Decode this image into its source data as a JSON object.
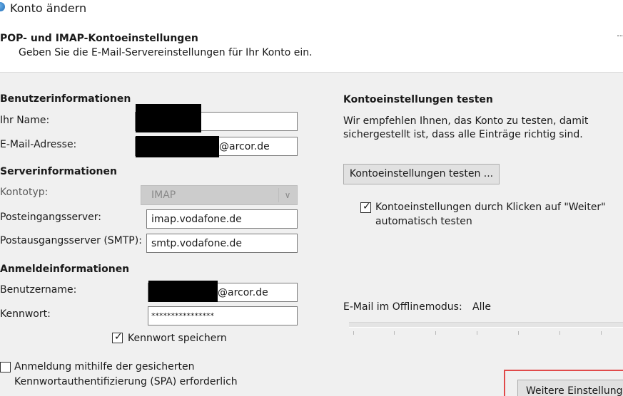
{
  "window": {
    "title": "Konto ändern"
  },
  "header": {
    "title": "POP- und IMAP-Kontoeinstellungen",
    "subtitle": "Geben Sie die E-Mail-Servereinstellungen für Ihr Konto ein."
  },
  "user_info": {
    "section": "Benutzerinformationen",
    "name_label": "Ihr Name:",
    "email_label": "E-Mail-Adresse:",
    "email_suffix": "@arcor.de"
  },
  "server_info": {
    "section": "Serverinformationen",
    "account_type_label": "Kontotyp:",
    "account_type_value": "IMAP",
    "incoming_label": "Posteingangsserver:",
    "incoming_value": "imap.vodafone.de",
    "outgoing_label": "Postausgangsserver (SMTP):",
    "outgoing_value": "smtp.vodafone.de"
  },
  "login_info": {
    "section": "Anmeldeinformationen",
    "username_label": "Benutzername:",
    "username_suffix": "@arcor.de",
    "password_label": "Kennwort:",
    "password_value": "****************",
    "save_password_label": "Kennwort speichern",
    "save_password_checked": true,
    "spa_label_line1": "Anmeldung mithilfe der gesicherten",
    "spa_label_line2": "Kennwortauthentifizierung (SPA) erforderlich",
    "spa_checked": false
  },
  "test": {
    "section": "Kontoeinstellungen testen",
    "description_line1": "Wir empfehlen Ihnen, das Konto zu testen, damit",
    "description_line2": "sichergestellt ist, dass alle Einträge richtig sind.",
    "test_button": "Kontoeinstellungen testen ...",
    "auto_test_line1": "Kontoeinstellungen durch Klicken auf \"Weiter\"",
    "auto_test_line2": "automatisch testen",
    "auto_test_checked": true
  },
  "offline": {
    "label": "E-Mail im Offlinemodus:",
    "value": "Alle"
  },
  "more_settings_button": "Weitere Einstellungen",
  "colors": {
    "highlight": "#e04a4a",
    "content_bg": "#f0f0f0"
  }
}
